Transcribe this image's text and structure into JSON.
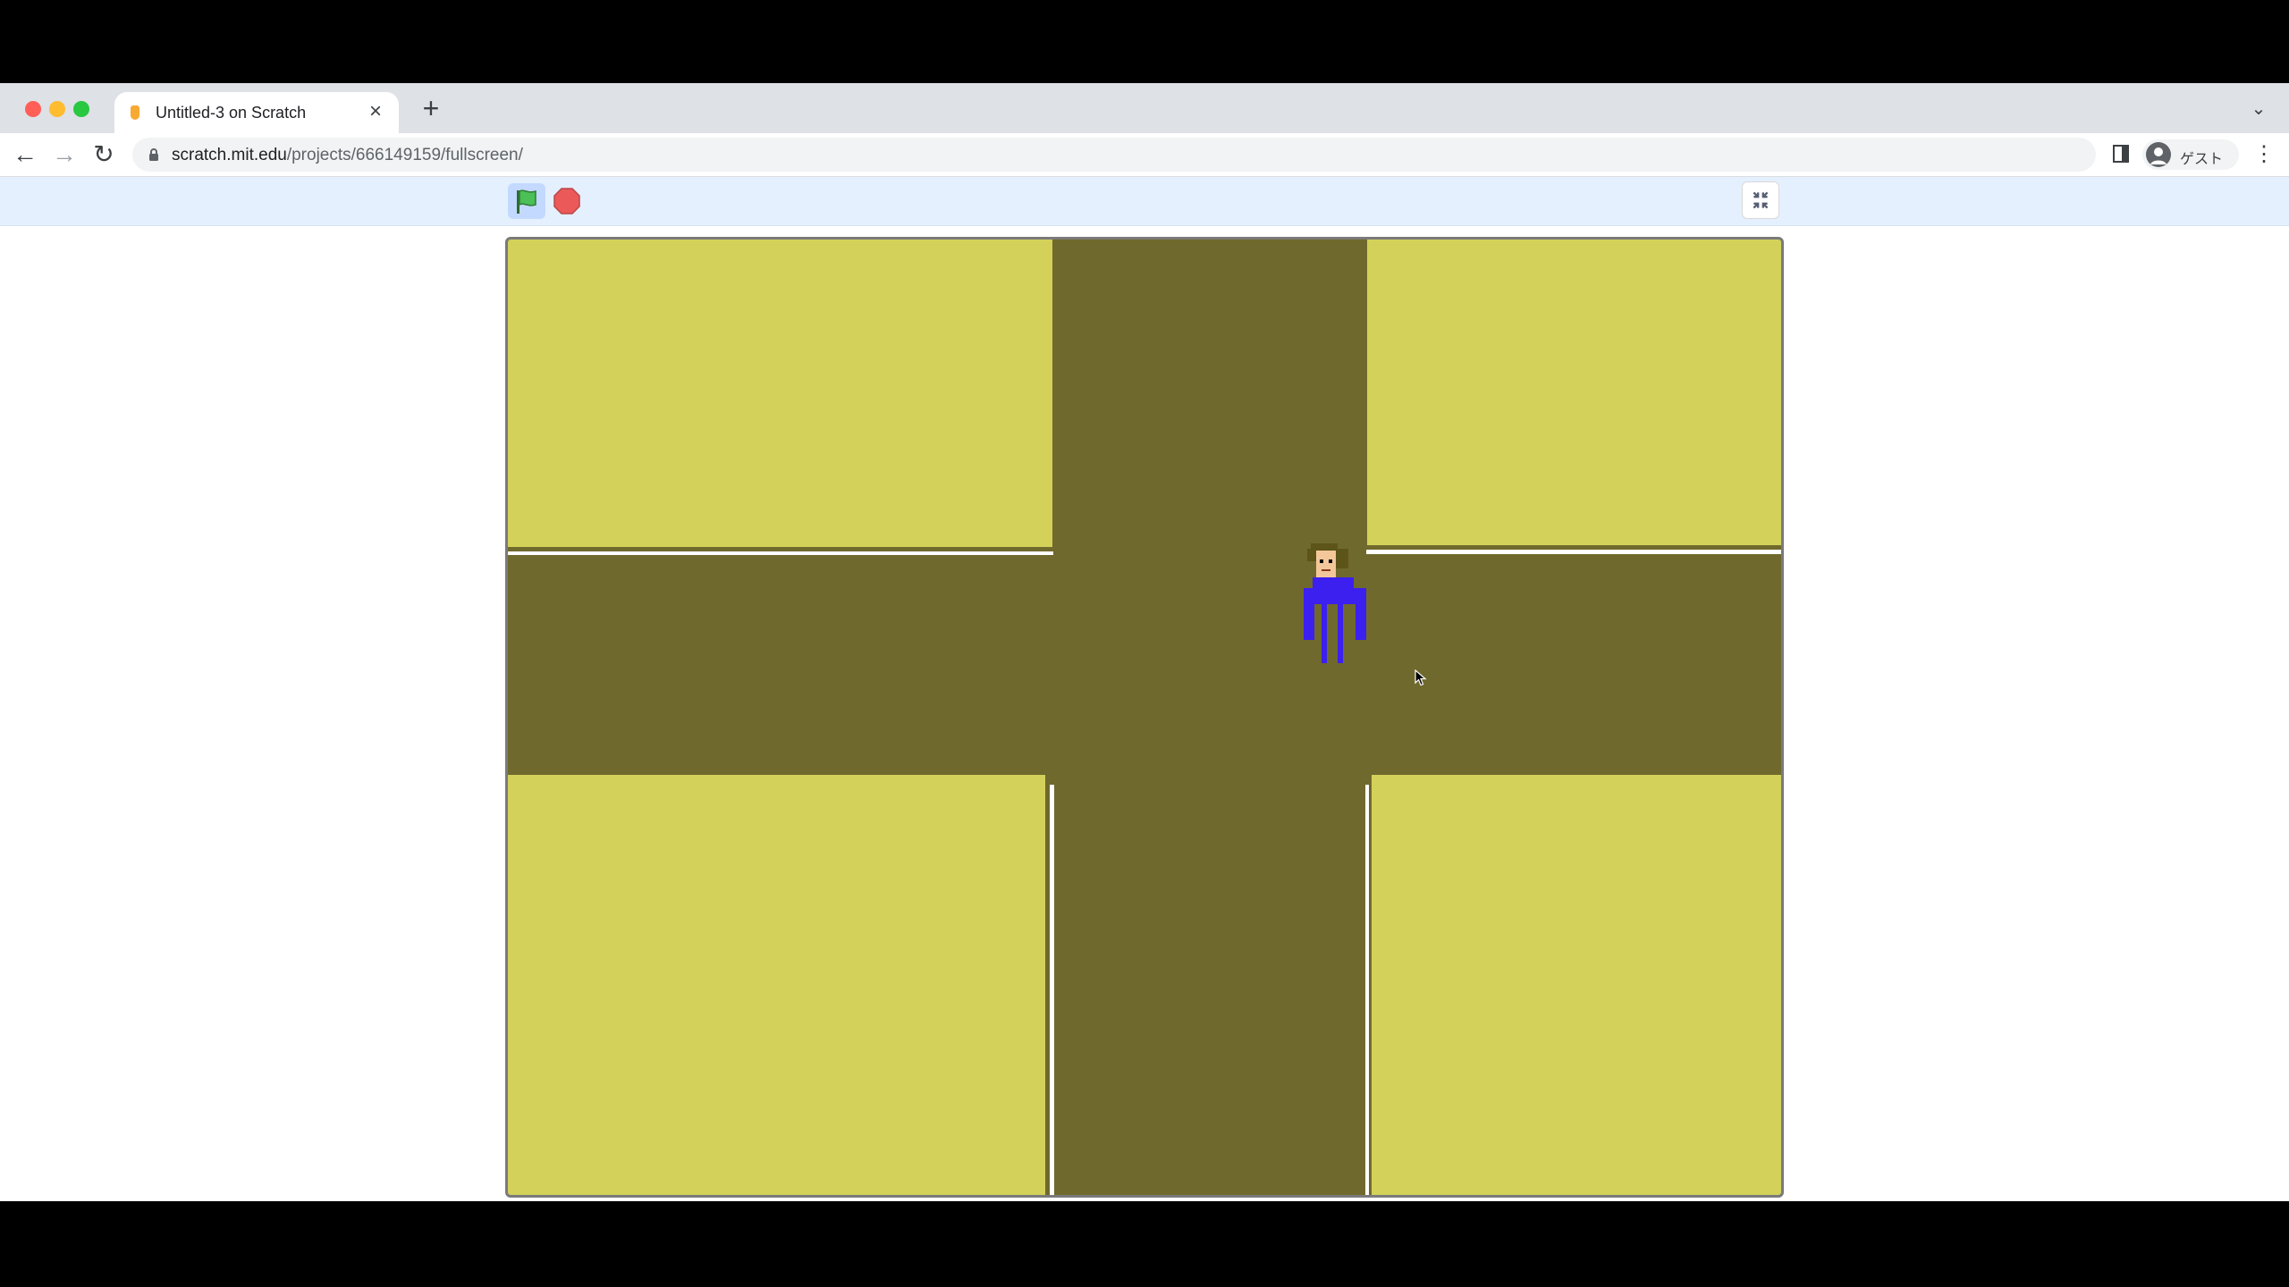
{
  "browser": {
    "tab": {
      "title": "Untitled-3 on Scratch"
    },
    "address_bar": {
      "host": "scratch.mit.edu",
      "path": "/projects/666149159/fullscreen/"
    },
    "profile": {
      "label": "ゲスト"
    }
  },
  "scratch": {
    "controls": [
      "green-flag",
      "stop-sign",
      "exit-fullscreen"
    ],
    "stage": {
      "colors": {
        "road": "#70692d",
        "block": "#d3d15a",
        "sprite_body": "#3b20f0",
        "hair": "#5c5418",
        "skin": "#f4c79a"
      },
      "sprite": "person-sprite"
    }
  }
}
